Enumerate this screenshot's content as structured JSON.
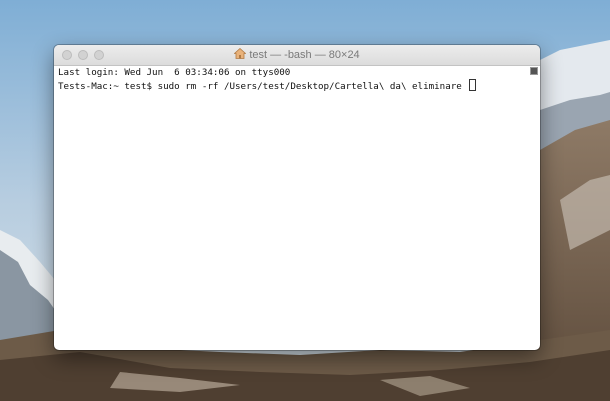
{
  "window": {
    "title": "test — -bash — 80×24",
    "title_icon": "home-icon"
  },
  "terminal": {
    "lines": [
      "Last login: Wed Jun  6 03:34:06 on ttys000",
      "Tests-Mac:~ test$ sudo rm -rf /Users/test/Desktop/Cartella\\ da\\ eliminare "
    ]
  },
  "colors": {
    "window_bg": "#ffffff",
    "titlebar_bg": "#e5e5e5",
    "text": "#111111"
  }
}
